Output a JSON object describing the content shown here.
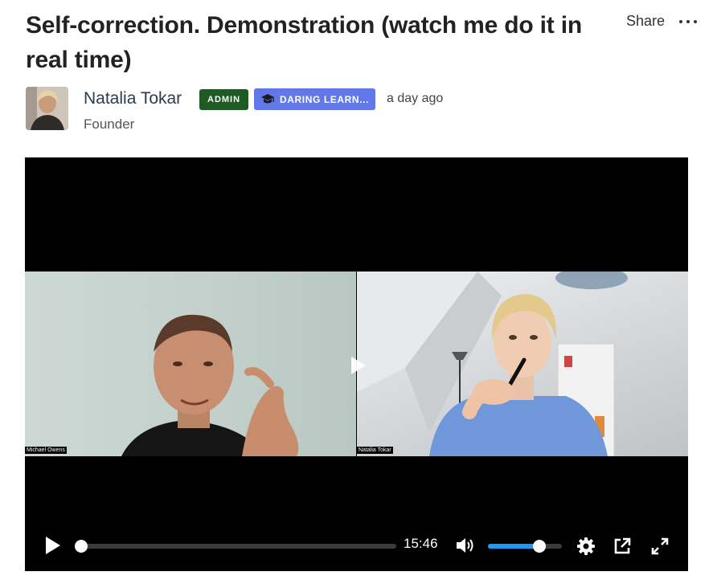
{
  "post": {
    "title": "Self-correction. Demonstration (watch me do it in real time)",
    "share_label": "Share",
    "more_icon": "more-horizontal-icon"
  },
  "author": {
    "name": "Natalia Tokar",
    "role": "Founder",
    "badge_admin": "ADMIN",
    "badge_group": "DARING LEARN...",
    "badge_group_icon": "graduation-cap-icon",
    "posted": "a day ago"
  },
  "video": {
    "participant_left": "Michael Owens",
    "participant_right": "Natalia Tokar",
    "duration": "15:46",
    "progress": 0.0,
    "volume": 0.7,
    "icons": {
      "play": "play-icon",
      "volume": "volume-icon",
      "settings": "settings-icon",
      "popout": "external-link-icon",
      "fullscreen": "fullscreen-icon"
    },
    "accent_color": "#1d9bf0"
  },
  "colors": {
    "admin_badge": "#1e5a23",
    "group_badge": "#6378e8"
  }
}
